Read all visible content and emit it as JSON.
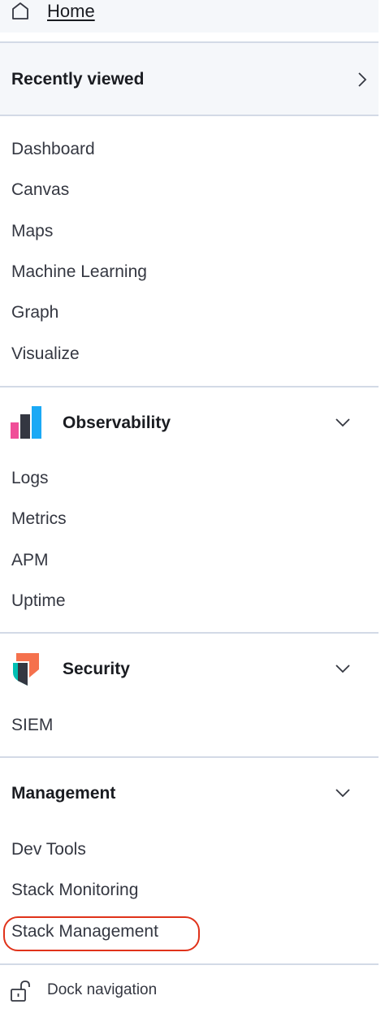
{
  "home": {
    "label": "Home",
    "icon": "home-icon"
  },
  "recently_viewed": {
    "title": "Recently viewed",
    "icon": "chevron-right-icon"
  },
  "analytics_items": [
    {
      "label": "Dashboard"
    },
    {
      "label": "Canvas"
    },
    {
      "label": "Maps"
    },
    {
      "label": "Machine Learning"
    },
    {
      "label": "Graph"
    },
    {
      "label": "Visualize"
    }
  ],
  "observability": {
    "title": "Observability",
    "icon": "observability-logo-icon",
    "items": [
      {
        "label": "Logs"
      },
      {
        "label": "Metrics"
      },
      {
        "label": "APM"
      },
      {
        "label": "Uptime"
      }
    ]
  },
  "security": {
    "title": "Security",
    "icon": "security-logo-icon",
    "items": [
      {
        "label": "SIEM"
      }
    ]
  },
  "management": {
    "title": "Management",
    "items": [
      {
        "label": "Dev Tools"
      },
      {
        "label": "Stack Monitoring"
      },
      {
        "label": "Stack Management"
      }
    ],
    "highlighted_item": "Stack Management",
    "highlight_color": "#e0321a"
  },
  "dock": {
    "label": "Dock navigation",
    "icon": "unlock-icon"
  }
}
